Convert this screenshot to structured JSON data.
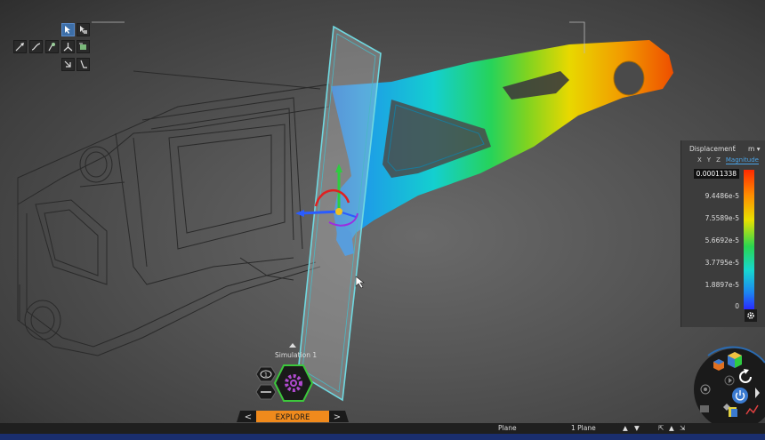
{
  "toolbar": {
    "tools": [
      "select-arrow-icon",
      "select-box-icon",
      "measure-arrow-icon",
      "sketch-curve-icon",
      "probe-icon",
      "triad-icon",
      "add-part-icon",
      "move-tool-icon",
      "reaction-icon"
    ]
  },
  "legend": {
    "title": "Displacement",
    "unit": "m",
    "tabs": [
      "X",
      "Y",
      "Z",
      "Magnitude"
    ],
    "selected_tab": "Magnitude",
    "values": [
      "0.00011338",
      "9.4486e-5",
      "7.5589e-5",
      "5.6692e-5",
      "3.7795e-5",
      "1.8897e-5",
      "0"
    ]
  },
  "simulation": {
    "label": "Simulation 1",
    "counter": "1"
  },
  "explore": {
    "label": "EXPLORE",
    "prev": "<",
    "next": ">"
  },
  "statusbar": {
    "selection_type": "Plane",
    "selection_count": "1 Plane"
  },
  "colors": {
    "accent_orange": "#f08a1c",
    "accent_green": "#3cc83c",
    "legend_highlight": "#4aa3e6",
    "background": "#555555"
  }
}
